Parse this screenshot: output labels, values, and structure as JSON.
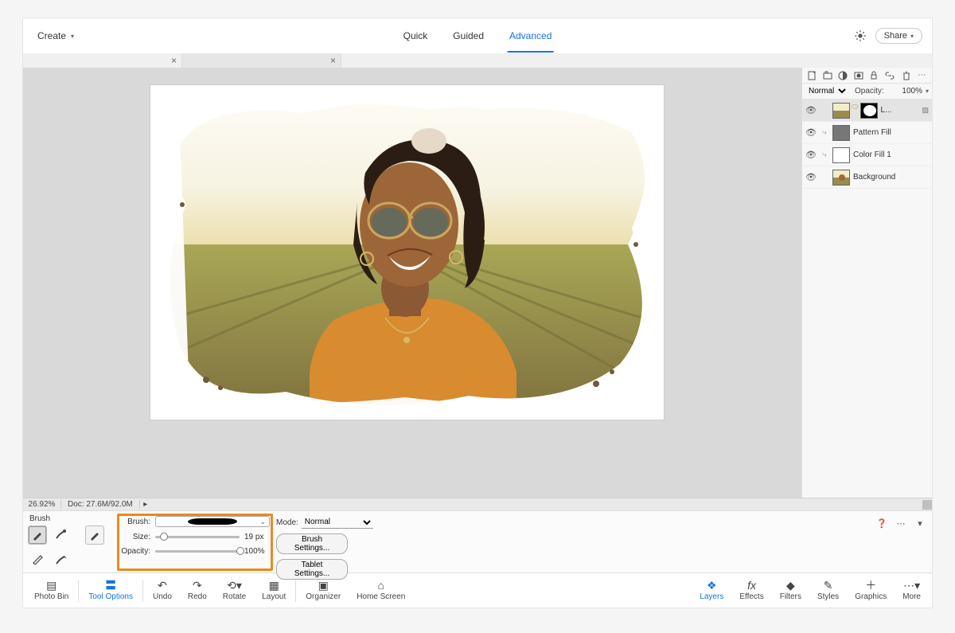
{
  "topbar": {
    "create": "Create",
    "tabs": {
      "quick": "Quick",
      "guided": "Guided",
      "advanced": "Advanced"
    },
    "share": "Share"
  },
  "status": {
    "zoom": "26.92%",
    "doc": "Doc: 27.6M/92.0M"
  },
  "tool_options": {
    "title": "Brush",
    "brush_label": "Brush:",
    "size_label": "Size:",
    "size_value": "19 px",
    "size_position_pct": 6,
    "opacity_label": "Opacity:",
    "opacity_value": "100%",
    "opacity_position_pct": 96,
    "mode_label": "Mode:",
    "mode_value": "Normal",
    "brush_settings": "Brush Settings...",
    "tablet_settings": "Tablet Settings..."
  },
  "layers": {
    "blend": "Normal",
    "opacity_label": "Opacity:",
    "opacity_value": "100%",
    "items": [
      {
        "name": "L..."
      },
      {
        "name": "Pattern Fill"
      },
      {
        "name": "Color Fill 1"
      },
      {
        "name": "Background"
      }
    ]
  },
  "bottom": {
    "photobin": "Photo Bin",
    "tooloptions": "Tool Options",
    "undo": "Undo",
    "redo": "Redo",
    "rotate": "Rotate",
    "layout": "Layout",
    "organizer": "Organizer",
    "homescreen": "Home Screen",
    "layers": "Layers",
    "effects": "Effects",
    "filters": "Filters",
    "styles": "Styles",
    "graphics": "Graphics",
    "more": "More"
  }
}
